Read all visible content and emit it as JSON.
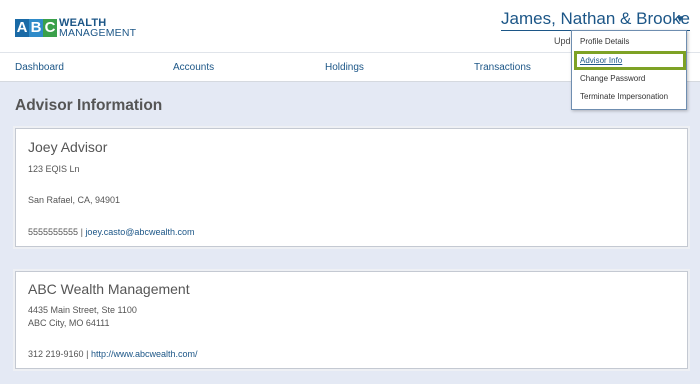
{
  "logo": {
    "a": "A",
    "b": "B",
    "c": "C",
    "line1": "WEALTH",
    "line2": "MANAGEMENT"
  },
  "header": {
    "user_name": "James, Nathan & Brooke",
    "caret_icon": "caret-down-icon",
    "upd_text": "Upd"
  },
  "nav": {
    "items": [
      "Dashboard",
      "Accounts",
      "Holdings",
      "Transactions"
    ]
  },
  "page": {
    "title": "Advisor Information"
  },
  "advisor": {
    "name": "Joey Advisor",
    "address1": "123 EQIS Ln",
    "address2": "San Rafael, CA, 94901",
    "phone": "5555555555",
    "separator": "|",
    "email": "joey.casto@abcwealth.com"
  },
  "firm": {
    "name": "ABC Wealth Management",
    "address1": "4435 Main Street, Ste 1100",
    "address2": "ABC City, MO 64111",
    "phone": "312 219-9160",
    "separator": "|",
    "website": "http://www.abcwealth.com/"
  },
  "dropdown": {
    "items": [
      "Profile Details",
      "Advisor Info",
      "Change Password",
      "Terminate Impersonation"
    ],
    "highlighted": "Advisor Info",
    "highlight_color": "#7ea225"
  },
  "colors": {
    "brand_blue": "#1c5687",
    "background": "#e4e9f4"
  }
}
